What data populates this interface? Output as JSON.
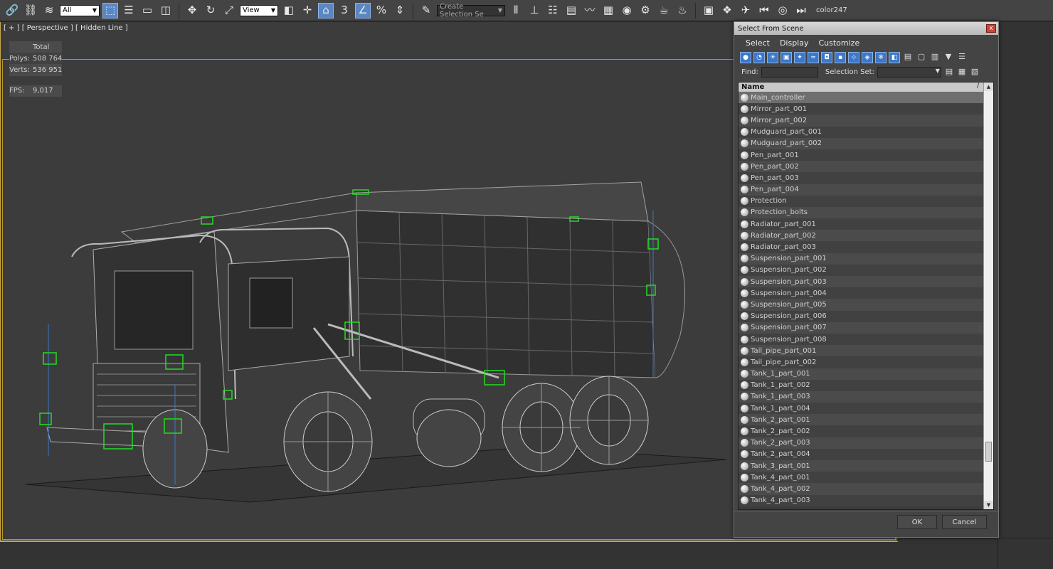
{
  "toolbar": {
    "filter_value": "All",
    "coord_value": "View",
    "snap_label": "3",
    "selection_set_placeholder": "Create Selection Se",
    "color_label": "color247"
  },
  "viewport": {
    "label": "[ + ] [ Perspective ] [ Hidden Line ]",
    "stats": {
      "header": "Total",
      "polys_label": "Polys:",
      "polys_value": "508 764",
      "verts_label": "Verts:",
      "verts_value": "536 951",
      "fps_label": "FPS:",
      "fps_value": "9,017"
    }
  },
  "dialog": {
    "title": "Select From Scene",
    "close": "x",
    "menu": [
      "Select",
      "Display",
      "Customize"
    ],
    "find_label": "Find:",
    "selection_set_label": "Selection Set:",
    "column_header": "Name",
    "sort_mark": "/",
    "ok": "OK",
    "cancel": "Cancel",
    "items": [
      "Main_controller",
      "Mirror_part_001",
      "Mirror_part_002",
      "Mudguard_part_001",
      "Mudguard_part_002",
      "Pen_part_001",
      "Pen_part_002",
      "Pen_part_003",
      "Pen_part_004",
      "Protection",
      "Protection_bolts",
      "Radiator_part_001",
      "Radiator_part_002",
      "Radiator_part_003",
      "Suspension_part_001",
      "Suspension_part_002",
      "Suspension_part_003",
      "Suspension_part_004",
      "Suspension_part_005",
      "Suspension_part_006",
      "Suspension_part_007",
      "Suspension_part_008",
      "Tail_pipe_part_001",
      "Tail_pipe_part_002",
      "Tank_1_part_001",
      "Tank_1_part_002",
      "Tank_1_part_003",
      "Tank_1_part_004",
      "Tank_2_part_001",
      "Tank_2_part_002",
      "Tank_2_part_003",
      "Tank_2_part_004",
      "Tank_3_part_001",
      "Tank_4_part_001",
      "Tank_4_part_002",
      "Tank_4_part_003"
    ],
    "selected_index": 0
  }
}
